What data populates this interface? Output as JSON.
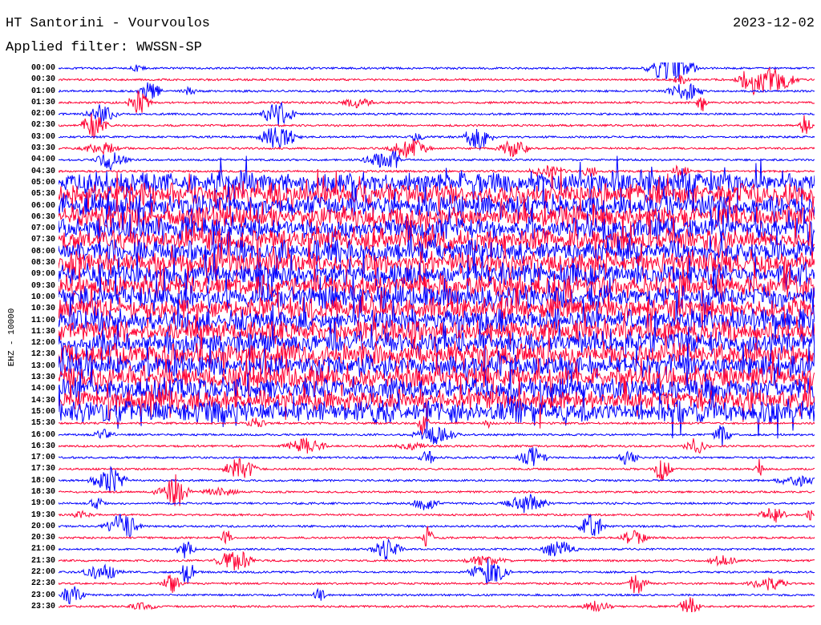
{
  "header": {
    "title": "HT Santorini - Vourvoulos",
    "date": "2023-12-02",
    "filter": "Applied filter: WWSSN-SP"
  },
  "channel_label": "EHZ - 10000",
  "traces": [
    {
      "time": "00:00",
      "color": "#0000ff",
      "kind": "quiet"
    },
    {
      "time": "00:30",
      "color": "#ff0033",
      "kind": "quiet"
    },
    {
      "time": "01:00",
      "color": "#0000ff",
      "kind": "quiet"
    },
    {
      "time": "01:30",
      "color": "#ff0033",
      "kind": "quiet"
    },
    {
      "time": "02:00",
      "color": "#0000ff",
      "kind": "quiet"
    },
    {
      "time": "02:30",
      "color": "#ff0033",
      "kind": "quiet"
    },
    {
      "time": "03:00",
      "color": "#0000ff",
      "kind": "quiet"
    },
    {
      "time": "03:30",
      "color": "#ff0033",
      "kind": "quiet"
    },
    {
      "time": "04:00",
      "color": "#0000ff",
      "kind": "quiet"
    },
    {
      "time": "04:30",
      "color": "#ff0033",
      "kind": "quiet"
    },
    {
      "time": "05:00",
      "color": "#0000ff",
      "kind": "busy"
    },
    {
      "time": "05:30",
      "color": "#ff0033",
      "kind": "busy"
    },
    {
      "time": "06:00",
      "color": "#0000ff",
      "kind": "busy"
    },
    {
      "time": "06:30",
      "color": "#ff0033",
      "kind": "busy"
    },
    {
      "time": "07:00",
      "color": "#0000ff",
      "kind": "busy"
    },
    {
      "time": "07:30",
      "color": "#ff0033",
      "kind": "busy"
    },
    {
      "time": "08:00",
      "color": "#0000ff",
      "kind": "busy"
    },
    {
      "time": "08:30",
      "color": "#ff0033",
      "kind": "busy"
    },
    {
      "time": "09:00",
      "color": "#0000ff",
      "kind": "busy"
    },
    {
      "time": "09:30",
      "color": "#ff0033",
      "kind": "busy"
    },
    {
      "time": "10:00",
      "color": "#0000ff",
      "kind": "busy"
    },
    {
      "time": "10:30",
      "color": "#ff0033",
      "kind": "busy"
    },
    {
      "time": "11:00",
      "color": "#0000ff",
      "kind": "busy"
    },
    {
      "time": "11:30",
      "color": "#ff0033",
      "kind": "busy"
    },
    {
      "time": "12:00",
      "color": "#0000ff",
      "kind": "busy"
    },
    {
      "time": "12:30",
      "color": "#ff0033",
      "kind": "busy"
    },
    {
      "time": "13:00",
      "color": "#0000ff",
      "kind": "busy"
    },
    {
      "time": "13:30",
      "color": "#ff0033",
      "kind": "busy"
    },
    {
      "time": "14:00",
      "color": "#0000ff",
      "kind": "busy"
    },
    {
      "time": "14:30",
      "color": "#ff0033",
      "kind": "busy"
    },
    {
      "time": "15:00",
      "color": "#0000ff",
      "kind": "busy"
    },
    {
      "time": "15:30",
      "color": "#ff0033",
      "kind": "quiet"
    },
    {
      "time": "16:00",
      "color": "#0000ff",
      "kind": "quiet"
    },
    {
      "time": "16:30",
      "color": "#ff0033",
      "kind": "quiet"
    },
    {
      "time": "17:00",
      "color": "#0000ff",
      "kind": "quiet"
    },
    {
      "time": "17:30",
      "color": "#ff0033",
      "kind": "quiet"
    },
    {
      "time": "18:00",
      "color": "#0000ff",
      "kind": "quiet"
    },
    {
      "time": "18:30",
      "color": "#ff0033",
      "kind": "quiet"
    },
    {
      "time": "19:00",
      "color": "#0000ff",
      "kind": "quiet"
    },
    {
      "time": "19:30",
      "color": "#ff0033",
      "kind": "quiet"
    },
    {
      "time": "20:00",
      "color": "#0000ff",
      "kind": "quiet"
    },
    {
      "time": "20:30",
      "color": "#ff0033",
      "kind": "quiet"
    },
    {
      "time": "21:00",
      "color": "#0000ff",
      "kind": "quiet"
    },
    {
      "time": "21:30",
      "color": "#ff0033",
      "kind": "quiet"
    },
    {
      "time": "22:00",
      "color": "#0000ff",
      "kind": "quiet"
    },
    {
      "time": "22:30",
      "color": "#ff0033",
      "kind": "quiet"
    },
    {
      "time": "23:00",
      "color": "#0000ff",
      "kind": "quiet"
    },
    {
      "time": "23:30",
      "color": "#ff0033",
      "kind": "quiet"
    }
  ]
}
